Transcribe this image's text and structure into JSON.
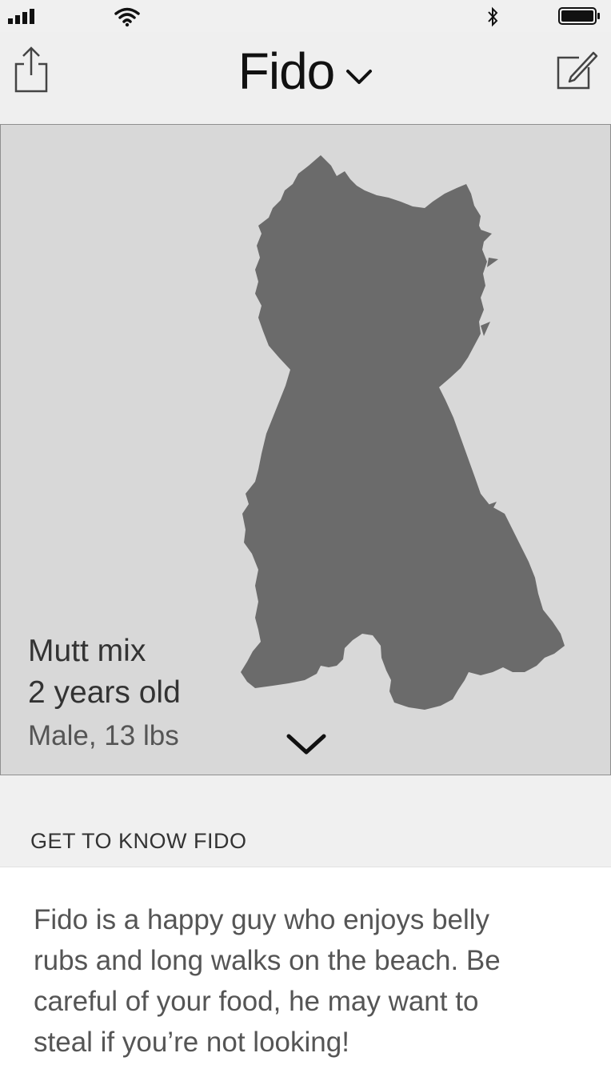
{
  "status_bar": {
    "signal_icon": "signal-bars-icon",
    "wifi_icon": "wifi-icon",
    "bluetooth_icon": "bluetooth-icon",
    "battery_icon": "battery-icon"
  },
  "nav": {
    "title": "Fido",
    "share_icon": "share-icon",
    "edit_icon": "edit-icon",
    "title_chevron_icon": "chevron-down-icon"
  },
  "pet": {
    "breed": "Mutt mix",
    "age": "2 years old",
    "sex_weight": "Male, 13 lbs",
    "silhouette_color": "#6b6b6b"
  },
  "section": {
    "header": "GET TO KNOW FIDO",
    "about": "Fido is a happy guy who enjoys belly rubs and long walks on the beach. Be careful of your food, he may want to steal if you’re not looking!"
  },
  "colors": {
    "background": "#f0f0f0",
    "hero_background": "#d8d8d8",
    "panel_background": "#ffffff"
  }
}
